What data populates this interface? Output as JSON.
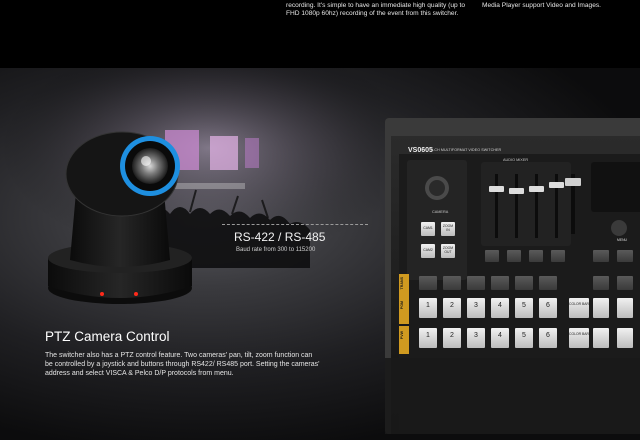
{
  "top": {
    "recording_text": "recording.  It's simple to have an immediate high quality (up to FHD 1080p 60hz) recording of the event from this switcher.",
    "media_player_text": "Media Player support Video and Images."
  },
  "spec": {
    "title": "RS-422 / RS-485",
    "subtitle": "Baud rate from 300 to 115200"
  },
  "ptz": {
    "heading": "PTZ Camera Control",
    "body": "The switcher also has a PTZ control feature. Two cameras' pan, tilt, zoom function can be controlled by a joystick and buttons through RS422/ RS485 port. Setting the cameras' address and select VISCA & Pelco D/P protocols from menu."
  },
  "switcher": {
    "model": "VS0605",
    "model_sub": "6-CH MULTIFORMAT VIDEO SWITCHER",
    "audio_mixer_label": "AUDIO MIXER",
    "camera_label": "CAMERA",
    "cam1": "CAM1",
    "cam2": "CAM2",
    "zoom_in": "ZOOM IN",
    "zoom_out": "ZOOM OUT",
    "row_labels": [
      "TRANS",
      "PGM",
      "PVW"
    ],
    "numbers": [
      "1",
      "2",
      "3",
      "4",
      "5",
      "6"
    ],
    "color_bar_1": "COLOR BAR",
    "color_bar_2": "COLOR BAR",
    "menu_label": "MENU"
  },
  "colors": {
    "lens_ring": "#1e8fe0",
    "row_label_bg": "#d09a20",
    "tally_red": "#ff2a1a"
  }
}
